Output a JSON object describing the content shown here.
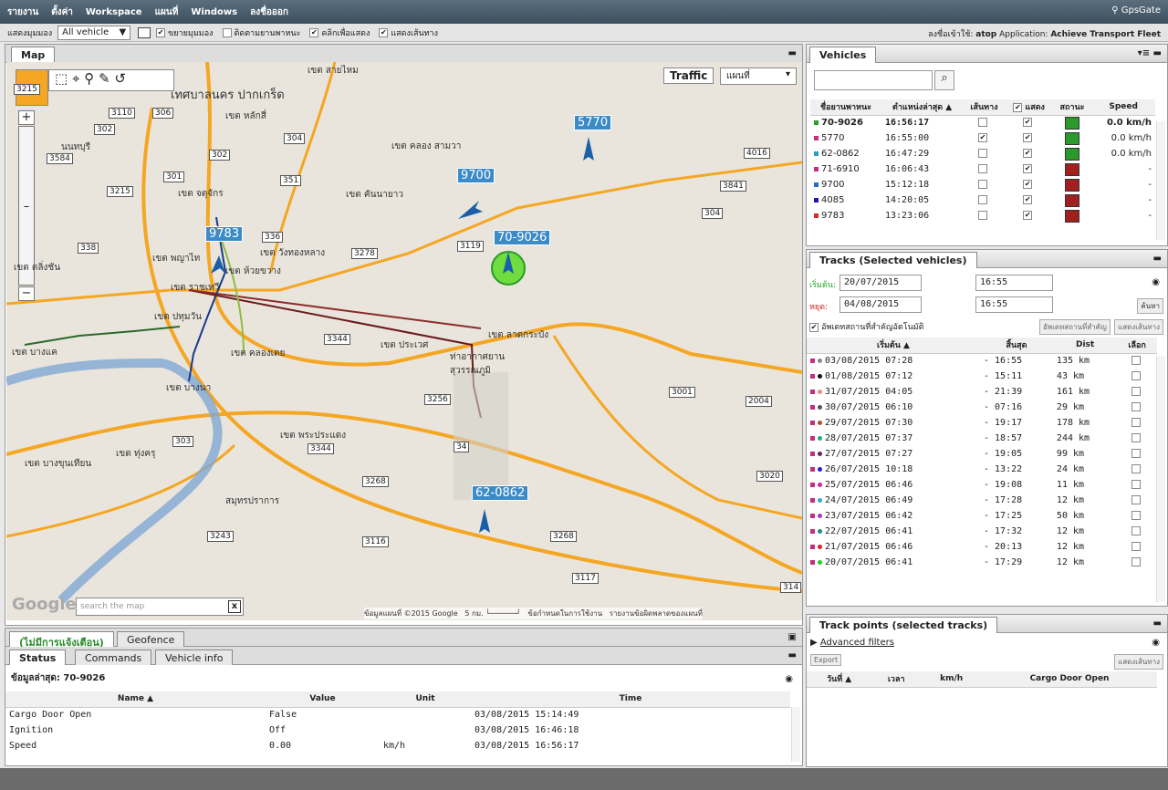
{
  "menu": {
    "items": [
      "รายงาน",
      "ตั้งค่า",
      "Workspace",
      "แผนที่",
      "Windows",
      "ลงชื่อออก"
    ],
    "logo": "GpsGate"
  },
  "toolbar": {
    "view_label": "แสดงมุมมอง",
    "vehicle_select": "All vehicle",
    "t1": "ขยายมุมมอง",
    "t2": "ติดตามยานพาหนะ",
    "t3": "คลิกเพื่อแสดง",
    "t4": "แสดงเส้นทาง",
    "login": "ลงชื่อเข้าใช้: ",
    "user": "atop",
    "app_label": "Application: ",
    "app": "Achieve Transport Fleet"
  },
  "map": {
    "tab": "Map",
    "traffic": "Traffic",
    "maptype": "แผนที่",
    "search_placeholder": "search the map",
    "copyright": "ข้อมูลแผนที่ ©2015 Google",
    "scale": "5 กม.",
    "terms": "ข้อกำหนดในการใช้งาน",
    "report": "รายงานข้อผิดพลาดของแผนที่",
    "google": "Google",
    "places": [
      "เทศบาลนคร ปากเกร็ด",
      "เขต หลักสี่",
      "เขต คลอง สามวา",
      "เขต คันนายาว",
      "เขต จตุจักร",
      "เขต วังทองหลาง",
      "เขต ห้วยขวาง",
      "เขต ราชเทวี",
      "เขต พญาไท",
      "เขต ตลิ่งชัน",
      "เขต ปทุมวัน",
      "เขต บางแค",
      "เขต คลองเตย",
      "เขต ประเวศ",
      "เขต ลาดกระบัง",
      "ท่าอากาศยาน สุวรรณภูมิ",
      "เขต บางนา",
      "เขต ทุ่งครุ",
      "เขต บางขุนเทียน",
      "เขต พระประแดง",
      "สมุทรปราการ",
      "นนทบุรี",
      "เขต สายไหม"
    ],
    "roads": [
      "3215",
      "3110",
      "306",
      "302",
      "3584",
      "302",
      "304",
      "301",
      "351",
      "4016",
      "3841",
      "3215",
      "304",
      "338",
      "336",
      "3278",
      "3119",
      "3344",
      "3256",
      "3001",
      "2004",
      "303",
      "3344",
      "34",
      "3268",
      "3020",
      "3243",
      "3116",
      "3268",
      "3117",
      "314"
    ],
    "vehicles": [
      "5770",
      "9700",
      "70-9026",
      "9783",
      "62-0862"
    ]
  },
  "vehicles": {
    "title": "Vehicles",
    "cols": [
      "ชื่อยานพาหนะ",
      "ตำแหน่งล่าสุด ▲",
      "เส้นทาง",
      "แสดง",
      "สถานะ",
      "Speed"
    ],
    "rows": [
      {
        "name": "70-9026",
        "time": "16:56:17",
        "track": false,
        "show": true,
        "status": "green",
        "speed": "0.0 km/h",
        "color": "#2e9c2e",
        "bold": true
      },
      {
        "name": "5770",
        "time": "16:55:00",
        "track": true,
        "show": true,
        "status": "green",
        "speed": "0.0 km/h",
        "color": "#c0307f",
        "bold": false
      },
      {
        "name": "62-0862",
        "time": "16:47:29",
        "track": false,
        "show": true,
        "status": "green",
        "speed": "0.0 km/h",
        "color": "#2a9fc0",
        "bold": false
      },
      {
        "name": "71-6910",
        "time": "16:06:43",
        "track": false,
        "show": true,
        "status": "red",
        "speed": "-",
        "color": "#c0307f",
        "bold": false
      },
      {
        "name": "9700",
        "time": "15:12:18",
        "track": false,
        "show": true,
        "status": "red",
        "speed": "-",
        "color": "#2a6fc0",
        "bold": false
      },
      {
        "name": "4085",
        "time": "14:20:05",
        "track": false,
        "show": true,
        "status": "red",
        "speed": "-",
        "color": "#1a1aa0",
        "bold": false
      },
      {
        "name": "9783",
        "time": "13:23:06",
        "track": false,
        "show": true,
        "status": "red",
        "speed": "-",
        "color": "#d03030",
        "bold": false
      }
    ]
  },
  "tracks": {
    "title": "Tracks (Selected vehicles)",
    "start_label": "เริ่มต้น:",
    "start_date": "20/07/2015",
    "start_time": "16:55",
    "stop_label": "หยุด:",
    "stop_date": "04/08/2015",
    "stop_time": "16:55",
    "search_btn": "ค้นหา",
    "auto_label": "อัพเดทสถานที่สำคัญอัตโนมัติ",
    "btn_update": "อัพเดทสถานที่สำคัญ",
    "btn_show": "แสดงเส้นทาง",
    "cols": [
      "เริ่มต้น ▲",
      "สิ้นสุด",
      "Dist",
      "เลือก"
    ],
    "rows": [
      {
        "start": "03/08/2015 07:28",
        "end": "- 16:55",
        "dist": "135 km",
        "dc": "#888"
      },
      {
        "start": "01/08/2015 07:12",
        "end": "- 15:11",
        "dist": "43 km",
        "dc": "#111"
      },
      {
        "start": "31/07/2015 04:05",
        "end": "- 21:39",
        "dist": "161 km",
        "dc": "#e88"
      },
      {
        "start": "30/07/2015 06:10",
        "end": "- 07:16",
        "dist": "29 km",
        "dc": "#555"
      },
      {
        "start": "29/07/2015 07:30",
        "end": "- 19:17",
        "dist": "178 km",
        "dc": "#a52"
      },
      {
        "start": "28/07/2015 07:37",
        "end": "- 18:57",
        "dist": "244 km",
        "dc": "#2a8"
      },
      {
        "start": "27/07/2015 07:27",
        "end": "- 19:05",
        "dist": "99 km",
        "dc": "#626"
      },
      {
        "start": "26/07/2015 10:18",
        "end": "- 13:22",
        "dist": "24 km",
        "dc": "#22c"
      },
      {
        "start": "25/07/2015 06:46",
        "end": "- 19:08",
        "dist": "11 km",
        "dc": "#c2a"
      },
      {
        "start": "24/07/2015 06:49",
        "end": "- 17:28",
        "dist": "12 km",
        "dc": "#3ac"
      },
      {
        "start": "23/07/2015 06:42",
        "end": "- 17:25",
        "dist": "50 km",
        "dc": "#a3c"
      },
      {
        "start": "22/07/2015 06:41",
        "end": "- 17:32",
        "dist": "12 km",
        "dc": "#288"
      },
      {
        "start": "21/07/2015 06:46",
        "end": "- 20:13",
        "dist": "12 km",
        "dc": "#d22"
      },
      {
        "start": "20/07/2015 06:41",
        "end": "- 17:29",
        "dist": "12 km",
        "dc": "#2c2"
      }
    ]
  },
  "trackpoints": {
    "title": "Track points (selected tracks)",
    "filters": "Advanced filters",
    "export": "Export",
    "show_btn": "แสดงเส้นทาง",
    "cols": [
      "วันที่ ▲",
      "เวลา",
      "km/h",
      "Cargo Door Open"
    ]
  },
  "bottom": {
    "tab_alerts": "(ไม่มีการแจ้งเตือน)",
    "tab_geofence": "Geofence",
    "tab_status": "Status",
    "tab_commands": "Commands",
    "tab_vinfo": "Vehicle info",
    "latest": "ข้อมูลล่าสุด: 70-9026",
    "cols": [
      "Name ▲",
      "Value",
      "Unit",
      "Time"
    ],
    "rows": [
      {
        "name": "Cargo Door Open",
        "value": "False",
        "unit": "",
        "time": "03/08/2015 15:14:49"
      },
      {
        "name": "Ignition",
        "value": "Off",
        "unit": "",
        "time": "03/08/2015 16:46:18"
      },
      {
        "name": "Speed",
        "value": "0.00",
        "unit": "km/h",
        "time": "03/08/2015 16:56:17"
      }
    ]
  }
}
